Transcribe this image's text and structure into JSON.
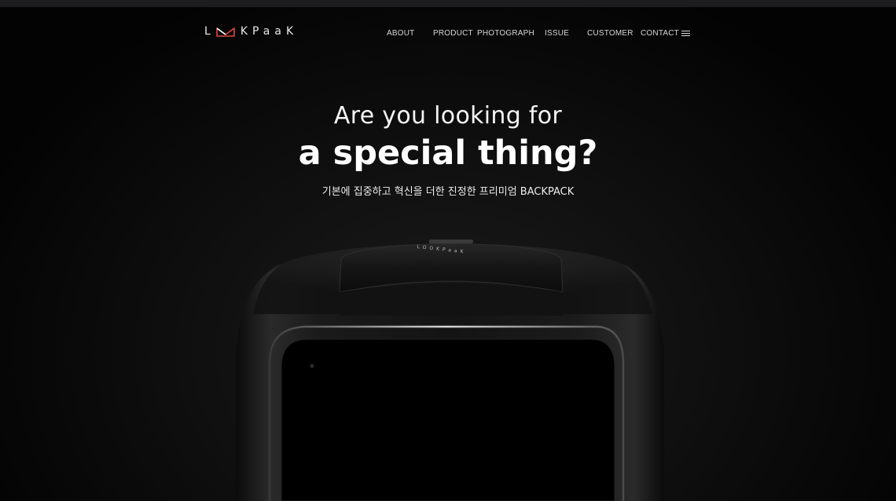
{
  "logo": {
    "text_left": "L",
    "text_right": "KPaaK",
    "accent_color": "#e0483a"
  },
  "nav": {
    "items": [
      {
        "label": "ABOUT"
      },
      {
        "label": "PRODUCT"
      },
      {
        "label": "PHOTOGRAPH"
      },
      {
        "label": "ISSUE"
      },
      {
        "label": "CUSTOMER"
      },
      {
        "label": "CONTACT"
      }
    ],
    "menu_icon": "hamburger-icon"
  },
  "hero": {
    "line1": "Are you looking for",
    "line2": "a special thing?",
    "subtitle": "기본에 집중하고 혁신을 더한 진정한 프리미엄 BACKPACK"
  },
  "product": {
    "brand_text": "LOOKPaaK",
    "image_name": "backpack-image"
  },
  "colors": {
    "background": "#000000",
    "top_strip": "#1d1d1f",
    "text": "#ffffff"
  }
}
